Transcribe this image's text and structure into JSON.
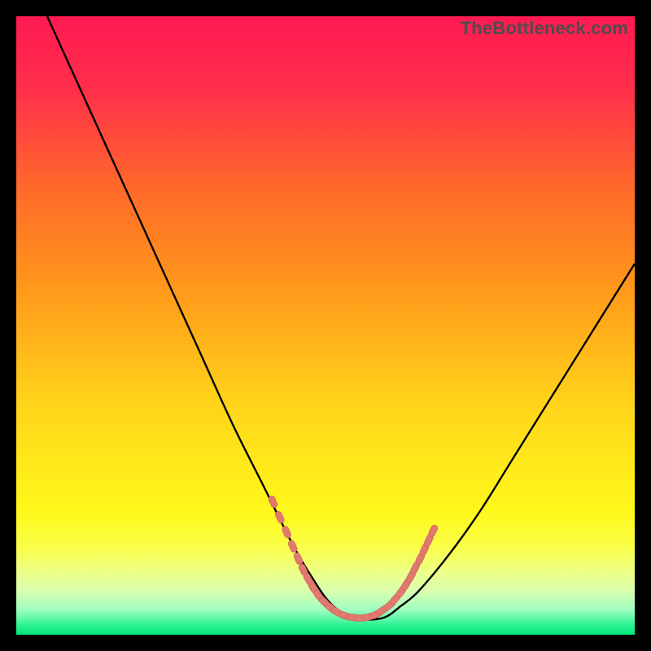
{
  "watermark": "TheBottleneck.com",
  "colors": {
    "black": "#000000",
    "gradient_stops": [
      {
        "offset": 0.0,
        "color": "#ff1a52"
      },
      {
        "offset": 0.12,
        "color": "#ff2f4a"
      },
      {
        "offset": 0.28,
        "color": "#ff6a2a"
      },
      {
        "offset": 0.45,
        "color": "#ff9b1a"
      },
      {
        "offset": 0.62,
        "color": "#ffd21a"
      },
      {
        "offset": 0.72,
        "color": "#ffe81a"
      },
      {
        "offset": 0.8,
        "color": "#fff81a"
      },
      {
        "offset": 0.86,
        "color": "#f9ff4a"
      },
      {
        "offset": 0.9,
        "color": "#ecff8a"
      },
      {
        "offset": 0.93,
        "color": "#d8ffb0"
      },
      {
        "offset": 0.96,
        "color": "#9effc0"
      },
      {
        "offset": 0.985,
        "color": "#2cf292"
      },
      {
        "offset": 1.0,
        "color": "#00e878"
      }
    ],
    "curve": "#000000",
    "marker_fill": "#e0796f",
    "marker_stroke": "#cf5f56"
  },
  "chart_data": {
    "type": "line",
    "title": "",
    "xlabel": "",
    "ylabel": "",
    "xlim": [
      0,
      100
    ],
    "ylim": [
      0,
      100
    ],
    "grid": false,
    "series": [
      {
        "name": "bottleneck-curve",
        "x": [
          5,
          10,
          15,
          20,
          25,
          30,
          35,
          40,
          45,
          48,
          50,
          52,
          54,
          56,
          58,
          60,
          62,
          65,
          70,
          75,
          80,
          85,
          90,
          95,
          100
        ],
        "y": [
          100,
          89,
          78,
          67,
          56,
          45,
          34,
          24,
          14,
          9,
          6,
          4,
          3,
          2.5,
          2.5,
          3,
          4.5,
          7,
          13,
          20,
          28,
          36,
          44,
          52,
          60
        ]
      }
    ],
    "markers": [
      {
        "x": 41.5,
        "y": 21.5
      },
      {
        "x": 42.6,
        "y": 19.0
      },
      {
        "x": 43.7,
        "y": 16.6
      },
      {
        "x": 44.7,
        "y": 14.3
      },
      {
        "x": 45.6,
        "y": 12.3
      },
      {
        "x": 46.4,
        "y": 10.5
      },
      {
        "x": 47.2,
        "y": 9.0
      },
      {
        "x": 48.0,
        "y": 7.6
      },
      {
        "x": 48.9,
        "y": 6.3
      },
      {
        "x": 49.8,
        "y": 5.3
      },
      {
        "x": 50.8,
        "y": 4.4
      },
      {
        "x": 51.8,
        "y": 3.7
      },
      {
        "x": 53.1,
        "y": 3.1
      },
      {
        "x": 54.4,
        "y": 2.8
      },
      {
        "x": 55.7,
        "y": 2.7
      },
      {
        "x": 57.0,
        "y": 2.9
      },
      {
        "x": 58.2,
        "y": 3.3
      },
      {
        "x": 59.3,
        "y": 4.0
      },
      {
        "x": 60.4,
        "y": 4.8
      },
      {
        "x": 61.3,
        "y": 5.8
      },
      {
        "x": 62.2,
        "y": 6.9
      },
      {
        "x": 63.0,
        "y": 8.1
      },
      {
        "x": 63.8,
        "y": 9.4
      },
      {
        "x": 64.5,
        "y": 10.8
      },
      {
        "x": 65.3,
        "y": 12.3
      },
      {
        "x": 66.0,
        "y": 13.8
      },
      {
        "x": 66.7,
        "y": 15.3
      },
      {
        "x": 67.4,
        "y": 16.8
      }
    ]
  }
}
